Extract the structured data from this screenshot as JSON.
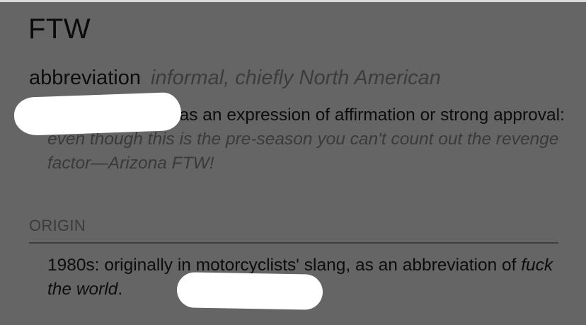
{
  "entry": {
    "headword": "FTW",
    "part_of_speech": "abbreviation",
    "register": "informal, chiefly North American"
  },
  "sense": {
    "definition": "for the win, used as an expression of affirmation or strong approval:",
    "example": "even though this is the pre-season you can't count out the revenge factor—Arizona FTW!"
  },
  "origin": {
    "label": "ORIGIN",
    "text_before": "1980s: originally in motorcyclists' slang, as an abbreviation of",
    "cited_phrase": "fuck the world",
    "text_after": "."
  },
  "annotations": {
    "redaction_color": "#ffffff"
  },
  "theme": {
    "background": "#656565",
    "text": "#0d0d0d",
    "muted_text": "#3a3a3a"
  }
}
